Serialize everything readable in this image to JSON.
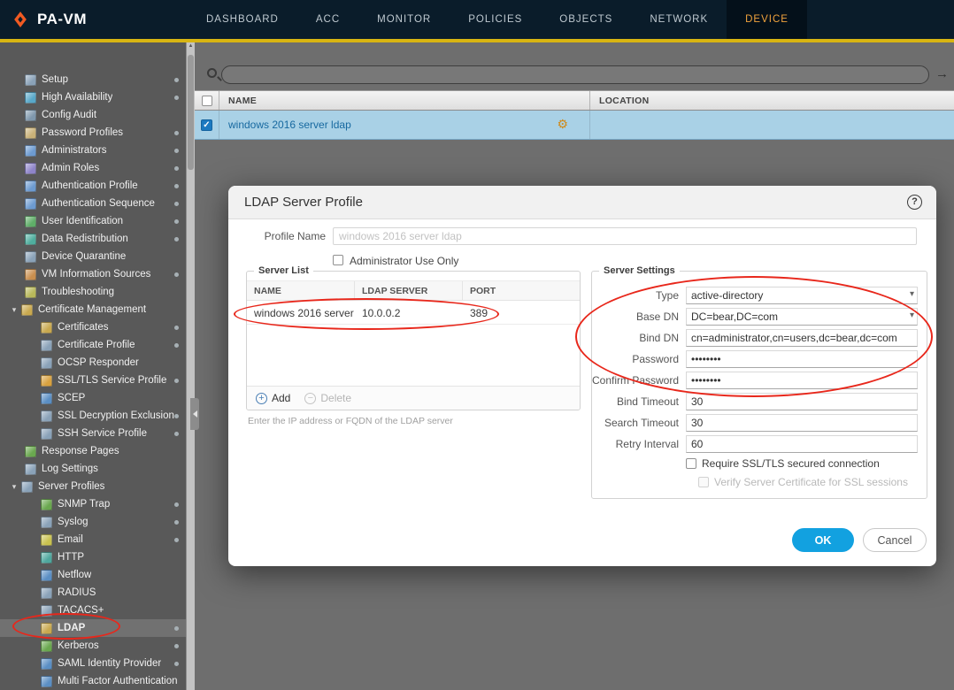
{
  "brand": {
    "name": "PA-VM"
  },
  "nav": {
    "items": [
      {
        "label": "DASHBOARD",
        "active": false
      },
      {
        "label": "ACC",
        "active": false
      },
      {
        "label": "MONITOR",
        "active": false
      },
      {
        "label": "POLICIES",
        "active": false
      },
      {
        "label": "OBJECTS",
        "active": false
      },
      {
        "label": "NETWORK",
        "active": false
      },
      {
        "label": "DEVICE",
        "active": true
      }
    ]
  },
  "sidebar": {
    "items": [
      {
        "label": "Setup",
        "icon": "setup-icon",
        "level": "root",
        "group": false,
        "dot": true,
        "selected": false,
        "color": "#8aa2b8"
      },
      {
        "label": "High Availability",
        "icon": "high-availability-icon",
        "level": "root",
        "group": false,
        "dot": true,
        "selected": false,
        "color": "#58a8c9"
      },
      {
        "label": "Config Audit",
        "icon": "config-audit-icon",
        "level": "root",
        "group": false,
        "dot": false,
        "selected": false,
        "color": "#7f98ad"
      },
      {
        "label": "Password Profiles",
        "icon": "password-profiles-icon",
        "level": "root",
        "group": false,
        "dot": true,
        "selected": false,
        "color": "#c9b178"
      },
      {
        "label": "Administrators",
        "icon": "administrators-icon",
        "level": "root",
        "group": false,
        "dot": true,
        "selected": false,
        "color": "#6d9bd1"
      },
      {
        "label": "Admin Roles",
        "icon": "admin-roles-icon",
        "level": "root",
        "group": false,
        "dot": true,
        "selected": false,
        "color": "#8e84c9"
      },
      {
        "label": "Authentication Profile",
        "icon": "authentication-profile-icon",
        "level": "root",
        "group": false,
        "dot": true,
        "selected": false,
        "color": "#6d9bd1"
      },
      {
        "label": "Authentication Sequence",
        "icon": "authentication-sequence-icon",
        "level": "root",
        "group": false,
        "dot": true,
        "selected": false,
        "color": "#6d9bd1"
      },
      {
        "label": "User Identification",
        "icon": "user-identification-icon",
        "level": "root",
        "group": false,
        "dot": true,
        "selected": false,
        "color": "#5fae68"
      },
      {
        "label": "Data Redistribution",
        "icon": "data-redistribution-icon",
        "level": "root",
        "group": false,
        "dot": true,
        "selected": false,
        "color": "#4fae9e"
      },
      {
        "label": "Device Quarantine",
        "icon": "device-quarantine-icon",
        "level": "root",
        "group": false,
        "dot": false,
        "selected": false,
        "color": "#8aa2b8"
      },
      {
        "label": "VM Information Sources",
        "icon": "vm-information-sources-icon",
        "level": "root",
        "group": false,
        "dot": true,
        "selected": false,
        "color": "#c98f4f"
      },
      {
        "label": "Troubleshooting",
        "icon": "troubleshooting-icon",
        "level": "root",
        "group": false,
        "dot": false,
        "selected": false,
        "color": "#b8b85a"
      },
      {
        "label": "Certificate Management",
        "icon": "certificate-management-icon",
        "level": "group",
        "group": true,
        "dot": false,
        "selected": false,
        "color": "#c9a94f"
      },
      {
        "label": "Certificates",
        "icon": "certificates-icon",
        "level": "child",
        "group": false,
        "dot": true,
        "selected": false,
        "color": "#c9a94f"
      },
      {
        "label": "Certificate Profile",
        "icon": "certificate-profile-icon",
        "level": "child",
        "group": false,
        "dot": true,
        "selected": false,
        "color": "#8aa2b8"
      },
      {
        "label": "OCSP Responder",
        "icon": "ocsp-responder-icon",
        "level": "child",
        "group": false,
        "dot": false,
        "selected": false,
        "color": "#8aa2b8"
      },
      {
        "label": "SSL/TLS Service Profile",
        "icon": "ssl-tls-service-profile-icon",
        "level": "child",
        "group": false,
        "dot": true,
        "selected": false,
        "color": "#d9a23f"
      },
      {
        "label": "SCEP",
        "icon": "scep-icon",
        "level": "child",
        "group": false,
        "dot": false,
        "selected": false,
        "color": "#5b8fc4"
      },
      {
        "label": "SSL Decryption Exclusion",
        "icon": "ssl-decryption-exclusion-icon",
        "level": "child",
        "group": false,
        "dot": true,
        "selected": false,
        "color": "#8aa2b8"
      },
      {
        "label": "SSH Service Profile",
        "icon": "ssh-service-profile-icon",
        "level": "child",
        "group": false,
        "dot": true,
        "selected": false,
        "color": "#8aa2b8"
      },
      {
        "label": "Response Pages",
        "icon": "response-pages-icon",
        "level": "root",
        "group": false,
        "dot": false,
        "selected": false,
        "color": "#6aa84f"
      },
      {
        "label": "Log Settings",
        "icon": "log-settings-icon",
        "level": "root",
        "group": false,
        "dot": false,
        "selected": false,
        "color": "#8aa2b8"
      },
      {
        "label": "Server Profiles",
        "icon": "server-profiles-icon",
        "level": "group",
        "group": true,
        "dot": false,
        "selected": false,
        "color": "#8aa2b8"
      },
      {
        "label": "SNMP Trap",
        "icon": "snmp-trap-icon",
        "level": "child",
        "group": false,
        "dot": true,
        "selected": false,
        "color": "#6aa84f"
      },
      {
        "label": "Syslog",
        "icon": "syslog-icon",
        "level": "child",
        "group": false,
        "dot": true,
        "selected": false,
        "color": "#8aa2b8"
      },
      {
        "label": "Email",
        "icon": "email-icon",
        "level": "child",
        "group": false,
        "dot": true,
        "selected": false,
        "color": "#c9c24f"
      },
      {
        "label": "HTTP",
        "icon": "http-icon",
        "level": "child",
        "group": false,
        "dot": false,
        "selected": false,
        "color": "#4fa89e"
      },
      {
        "label": "Netflow",
        "icon": "netflow-icon",
        "level": "child",
        "group": false,
        "dot": false,
        "selected": false,
        "color": "#5b8fc4"
      },
      {
        "label": "RADIUS",
        "icon": "radius-icon",
        "level": "child",
        "group": false,
        "dot": false,
        "selected": false,
        "color": "#8aa2b8"
      },
      {
        "label": "TACACS+",
        "icon": "tacacs-icon",
        "level": "child",
        "group": false,
        "dot": false,
        "selected": false,
        "color": "#8aa2b8"
      },
      {
        "label": "LDAP",
        "icon": "ldap-icon",
        "level": "child",
        "group": false,
        "dot": true,
        "selected": true,
        "color": "#c9a94f"
      },
      {
        "label": "Kerberos",
        "icon": "kerberos-icon",
        "level": "child",
        "group": false,
        "dot": true,
        "selected": false,
        "color": "#6aa84f"
      },
      {
        "label": "SAML Identity Provider",
        "icon": "saml-identity-provider-icon",
        "level": "child",
        "group": false,
        "dot": true,
        "selected": false,
        "color": "#5b8fc4"
      },
      {
        "label": "Multi Factor Authentication",
        "icon": "multi-factor-authentication-icon",
        "level": "child",
        "group": false,
        "dot": false,
        "selected": false,
        "color": "#5b8fc4"
      }
    ]
  },
  "search": {
    "value": ""
  },
  "main": {
    "columns": [
      "NAME",
      "LOCATION"
    ],
    "rows": [
      {
        "name": "windows 2016 server ldap",
        "location": "",
        "checked": true
      }
    ]
  },
  "dialog": {
    "title": "LDAP Server Profile",
    "profile_name": {
      "label": "Profile Name",
      "value": "windows 2016 server ldap"
    },
    "admin_only_label": "Administrator Use Only",
    "server_list": {
      "legend": "Server List",
      "columns": [
        "NAME",
        "LDAP SERVER",
        "PORT"
      ],
      "rows": [
        {
          "name": "windows 2016 server",
          "server": "10.0.0.2",
          "port": "389"
        }
      ],
      "add_label": "Add",
      "delete_label": "Delete",
      "hint": "Enter the IP address or FQDN of the LDAP server"
    },
    "server_settings": {
      "legend": "Server Settings",
      "fields": [
        {
          "label": "Type",
          "value": "active-directory",
          "select": true
        },
        {
          "label": "Base DN",
          "value": "DC=bear,DC=com",
          "select": true
        },
        {
          "label": "Bind DN",
          "value": "cn=administrator,cn=users,dc=bear,dc=com",
          "select": false
        },
        {
          "label": "Password",
          "value": "••••••••",
          "select": false
        },
        {
          "label": "Confirm Password",
          "value": "••••••••",
          "select": false
        },
        {
          "label": "Bind Timeout",
          "value": "30",
          "select": false
        },
        {
          "label": "Search Timeout",
          "value": "30",
          "select": false
        },
        {
          "label": "Retry Interval",
          "value": "60",
          "select": false
        }
      ],
      "checkboxes": [
        {
          "label": "Require SSL/TLS secured connection",
          "checked": false,
          "disabled": false
        },
        {
          "label": "Verify Server Certificate for SSL sessions",
          "checked": false,
          "disabled": true
        }
      ]
    },
    "ok_label": "OK",
    "cancel_label": "Cancel"
  },
  "icons": {
    "gear": "⚙",
    "chevron_down": "▾",
    "check": "✓",
    "apply_arrow": "→",
    "scroll_up": "▲",
    "help": "?",
    "plus": "+",
    "minus": "−"
  },
  "theme": {
    "nav_bg": "#0a1c2a",
    "accent_bar": "#d8b512",
    "active_tab": "#f1a33c",
    "brand_orange": "#f15a22",
    "selected_row": "#a9d1e6",
    "link_blue": "#1769a0",
    "ok_blue": "#12a1e0",
    "annotation_red": "#e8271b"
  }
}
